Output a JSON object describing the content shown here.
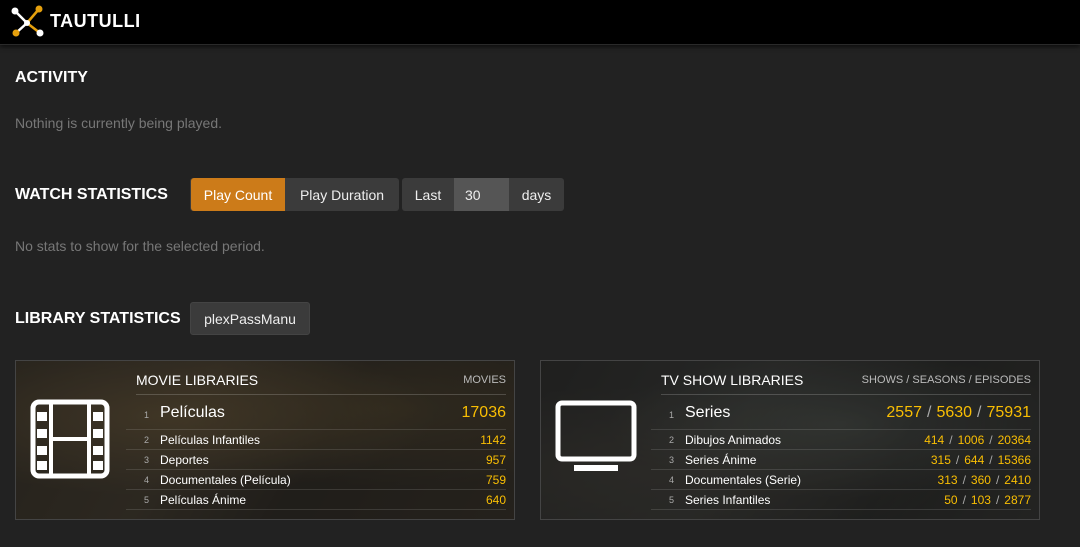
{
  "app": {
    "name": "TAUTULLI"
  },
  "activity": {
    "title": "ACTIVITY",
    "empty_text": "Nothing is currently being played."
  },
  "watch_stats": {
    "title": "WATCH STATISTICS",
    "play_count_label": "Play Count",
    "play_duration_label": "Play Duration",
    "last_label": "Last",
    "days_value": "30",
    "days_label": "days",
    "empty_text": "No stats to show for the selected period."
  },
  "library_stats": {
    "title": "LIBRARY STATISTICS",
    "server_button": "plexPassManu",
    "movie_card": {
      "title": "MOVIE LIBRARIES",
      "type_label": "MOVIES",
      "icon": "film-icon",
      "rows": [
        {
          "rank": "1",
          "name": "Películas",
          "count": "17036"
        },
        {
          "rank": "2",
          "name": "Películas Infantiles",
          "count": "1142"
        },
        {
          "rank": "3",
          "name": "Deportes",
          "count": "957"
        },
        {
          "rank": "4",
          "name": "Documentales (Película)",
          "count": "759"
        },
        {
          "rank": "5",
          "name": "Películas Ánime",
          "count": "640"
        }
      ]
    },
    "tv_card": {
      "title": "TV SHOW LIBRARIES",
      "type_label": "SHOWS / SEASONS / EPISODES",
      "icon": "tv-icon",
      "separator": "/",
      "rows": [
        {
          "rank": "1",
          "name": "Series",
          "shows": "2557",
          "seasons": "5630",
          "episodes": "75931"
        },
        {
          "rank": "2",
          "name": "Dibujos Animados",
          "shows": "414",
          "seasons": "1006",
          "episodes": "20364"
        },
        {
          "rank": "3",
          "name": "Series Ánime",
          "shows": "315",
          "seasons": "644",
          "episodes": "15366"
        },
        {
          "rank": "4",
          "name": "Documentales (Serie)",
          "shows": "313",
          "seasons": "360",
          "episodes": "2410"
        },
        {
          "rank": "5",
          "name": "Series Infantiles",
          "shows": "50",
          "seasons": "103",
          "episodes": "2877"
        }
      ]
    }
  },
  "colors": {
    "accent": "#cc7b19",
    "count": "#f9be03",
    "background": "#222222",
    "navbar": "#000000"
  }
}
